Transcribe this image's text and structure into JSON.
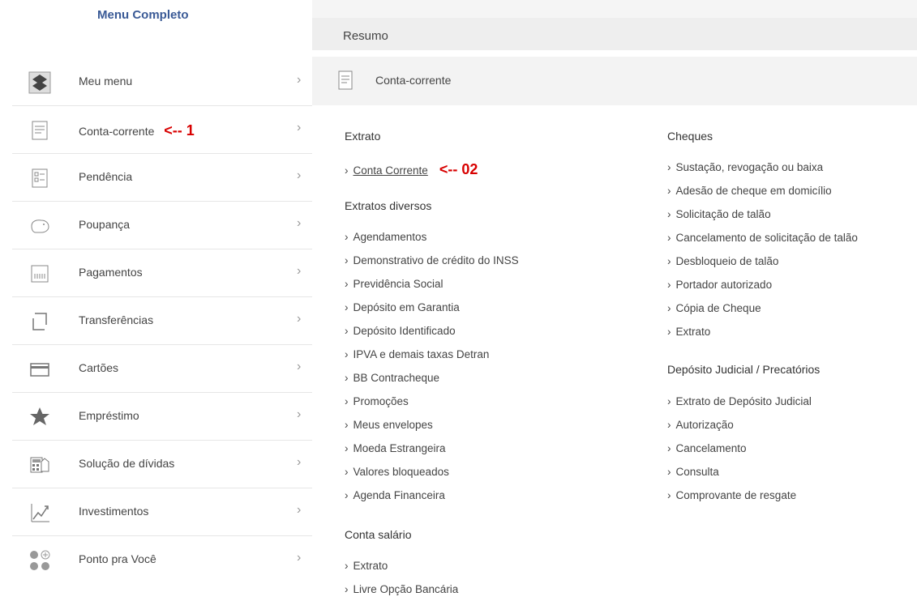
{
  "menu": {
    "title": "Menu Completo",
    "items": [
      {
        "icon": "bb-logo-icon",
        "label": "Meu menu",
        "chev": "›"
      },
      {
        "icon": "document-icon",
        "label": "Conta-corrente",
        "annotation": "<-- 1",
        "chev": "›"
      },
      {
        "icon": "checklist-icon",
        "label": "Pendência",
        "chev": "›"
      },
      {
        "icon": "piggy-bank-icon",
        "label": "Poupança",
        "chev": "›"
      },
      {
        "icon": "barcode-icon",
        "label": "Pagamentos",
        "chev": "›"
      },
      {
        "icon": "transfer-icon",
        "label": "Transferências",
        "chev": "›"
      },
      {
        "icon": "card-icon",
        "label": "Cartões",
        "chev": "›"
      },
      {
        "icon": "star-dollar-icon",
        "label": "Empréstimo",
        "chev": "›"
      },
      {
        "icon": "calculator-icon",
        "label": "Solução de dívidas",
        "chev": "›"
      },
      {
        "icon": "chart-up-icon",
        "label": "Investimentos",
        "chev": "›"
      },
      {
        "icon": "dots-plus-icon",
        "label": "Ponto pra Você",
        "chev": "›"
      }
    ]
  },
  "right": {
    "resumo": "Resumo",
    "header": "Conta-corrente",
    "col1": {
      "extrato": "Extrato",
      "conta_corrente": "Conta Corrente",
      "conta_corrente_annotation": "<-- 02",
      "extratos_diversos": "Extratos diversos",
      "diversos_items": [
        "Agendamentos",
        "Demonstrativo de crédito do INSS",
        "Previdência Social",
        "Depósito em Garantia",
        "Depósito Identificado",
        "IPVA e demais taxas Detran",
        "BB Contracheque",
        "Promoções",
        "Meus envelopes",
        "Moeda Estrangeira",
        "Valores bloqueados",
        "Agenda Financeira"
      ],
      "conta_salario": "Conta salário",
      "salario_items": [
        "Extrato",
        "Livre Opção Bancária"
      ]
    },
    "col2": {
      "cheques": "Cheques",
      "cheques_items": [
        "Sustação, revogação ou baixa",
        "Adesão de cheque em domicílio",
        "Solicitação de talão",
        "Cancelamento de solicitação de talão",
        "Desbloqueio de talão",
        "Portador autorizado",
        "Cópia de Cheque",
        "Extrato"
      ],
      "judicial": "Depósito Judicial / Precatórios",
      "judicial_items": [
        "Extrato de Depósito Judicial",
        "Autorização",
        "Cancelamento",
        "Consulta",
        "Comprovante de resgate"
      ]
    },
    "chevron": "›"
  }
}
